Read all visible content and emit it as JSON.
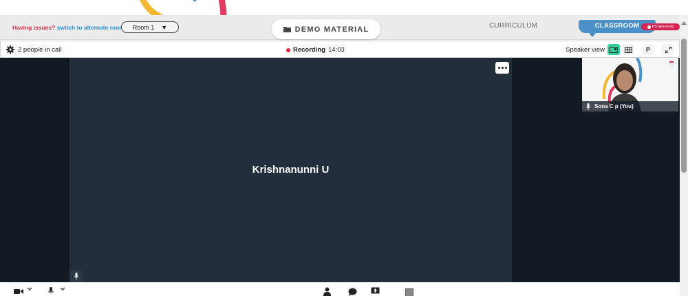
{
  "header": {
    "issues_prefix": "Having issues?",
    "issues_link": "switch to alternate room",
    "room_value": "Room 1",
    "demo_material": "DEMO MATERIAL",
    "curriculum": "CURRICULUM",
    "classroom": "CLASSROOM",
    "moments": "PS Moments"
  },
  "call": {
    "people_count": "2 people in call",
    "recording_label": "Recording",
    "recording_time": "14:03",
    "speaker_view": "Speaker view",
    "p_button": "P"
  },
  "participants": {
    "main_name": "Krishnanunni U",
    "self_name": "Sona C p (You)"
  },
  "colors": {
    "accent_green": "#34d1a0",
    "classroom_blue": "#4a90c9",
    "record_red": "#e0243c",
    "tile_bg": "#222e3b"
  }
}
